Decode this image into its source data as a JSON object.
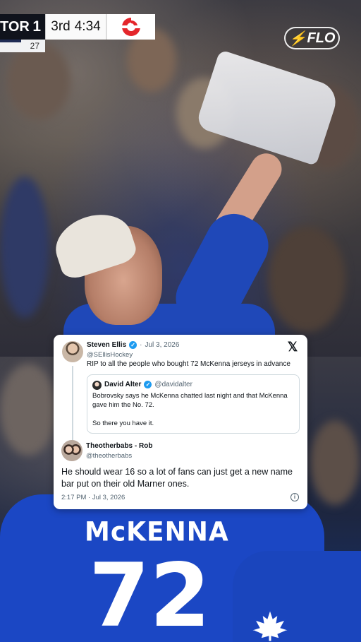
{
  "scorebug": {
    "team": "TOR",
    "score": "1",
    "sub_value": "27",
    "period": "3rd",
    "clock": "4:34"
  },
  "overlay": {
    "logo_text": "FLO"
  },
  "jersey": {
    "name": "McKENNA",
    "number": "72"
  },
  "tweet": {
    "author": {
      "name": "Steven Ellis",
      "handle": "@SEllisHockey",
      "date": "Jul 3, 2026",
      "text": "RIP to all the people who bought 72 McKenna jerseys in advance"
    },
    "quoted": {
      "name": "David Alter",
      "handle": "@davidalter",
      "text_line1": "Bobrovsky says he McKenna chatted last night and that McKenna gave him the No. 72.",
      "text_line2": "So there you have it."
    },
    "reply": {
      "name": "Theotherbabs - Rob",
      "handle": "@theotherbabs",
      "text": "He should wear 16 so a lot of fans can just get a new name bar put on their old Marner ones."
    },
    "footer": {
      "timestamp": "2:17 PM · Jul 3, 2026"
    },
    "separator": "·",
    "verified_mark": "✓"
  },
  "colors": {
    "jersey_blue": "#1b47c4",
    "flo_red": "#e4262b",
    "sponsor_red": "#e4262b",
    "verified_blue": "#1d9bf0"
  },
  "icons": {
    "close": "x-logo-icon",
    "info": "info-icon",
    "sponsor": "sponsor-logo-icon"
  }
}
